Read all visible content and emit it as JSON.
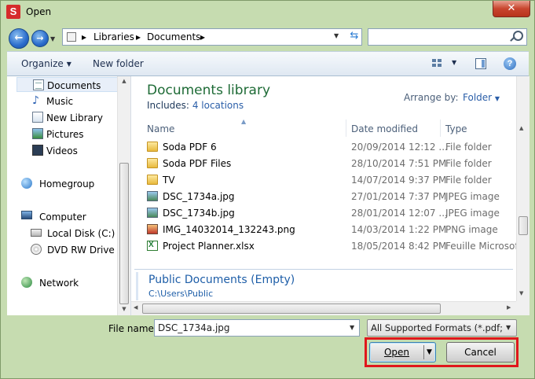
{
  "window": {
    "title": "Open",
    "app_icon_letter": "S"
  },
  "address": {
    "segments": [
      "Libraries",
      "Documents"
    ],
    "separator": "▸"
  },
  "search": {
    "placeholder": "",
    "value": ""
  },
  "toolbar": {
    "organize": "Organize",
    "new_folder": "New folder"
  },
  "nav": {
    "items": [
      {
        "label": "Documents",
        "icon": "documents-icon",
        "selected": true
      },
      {
        "label": "Music",
        "icon": "music-icon"
      },
      {
        "label": "New Library",
        "icon": "library-icon"
      },
      {
        "label": "Pictures",
        "icon": "pictures-icon"
      },
      {
        "label": "Videos",
        "icon": "videos-icon"
      },
      {
        "label": "Homegroup",
        "icon": "homegroup-icon"
      },
      {
        "label": "Computer",
        "icon": "computer-icon"
      },
      {
        "label": "Local Disk (C:)",
        "icon": "disk-icon"
      },
      {
        "label": "DVD RW Drive (D",
        "icon": "dvd-icon"
      },
      {
        "label": "Network",
        "icon": "network-icon"
      }
    ]
  },
  "library": {
    "title": "Documents library",
    "includes_label": "Includes:",
    "includes_link": "4 locations",
    "arrange_label": "Arrange by:",
    "arrange_value": "Folder"
  },
  "columns": {
    "name": "Name",
    "date": "Date modified",
    "type": "Type"
  },
  "files": [
    {
      "name": "Soda PDF 6",
      "date": "20/09/2014 12:12 ...",
      "type": "File folder",
      "icon": "folder"
    },
    {
      "name": "Soda PDF Files",
      "date": "28/10/2014 7:51 PM",
      "type": "File folder",
      "icon": "folder"
    },
    {
      "name": "TV",
      "date": "14/07/2014 9:37 PM",
      "type": "File folder",
      "icon": "folder"
    },
    {
      "name": "DSC_1734a.jpg",
      "date": "27/01/2014 7:37 PM",
      "type": "JPEG image",
      "icon": "jpg"
    },
    {
      "name": "DSC_1734b.jpg",
      "date": "28/01/2014 12:07 ...",
      "type": "JPEG image",
      "icon": "jpg"
    },
    {
      "name": "IMG_14032014_132243.png",
      "date": "14/03/2014 1:22 PM",
      "type": "PNG image",
      "icon": "png"
    },
    {
      "name": "Project Planner.xlsx",
      "date": "18/05/2014 8:42 PM",
      "type": "Feuille Microsoft",
      "icon": "xlsx"
    }
  ],
  "public_group": {
    "title": "Public Documents (Empty)",
    "path": "C:\\Users\\Public"
  },
  "bottom": {
    "file_name_label": "File name:",
    "file_name_value": "DSC_1734a.jpg",
    "filter_value": "All Supported Formats (*.pdf;*.d",
    "open_label": "Open",
    "cancel_label": "Cancel"
  },
  "colors": {
    "highlight": "#e0171c",
    "library_title": "#1e6b36",
    "link": "#2a5ea8"
  }
}
